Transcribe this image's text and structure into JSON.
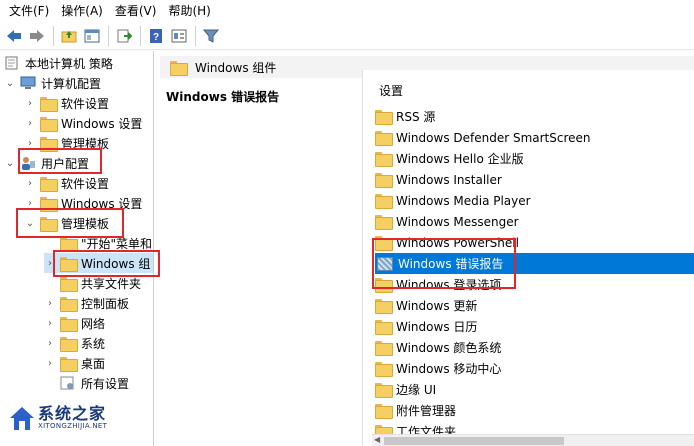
{
  "menu": [
    "文件(F)",
    "操作(A)",
    "查看(V)",
    "帮助(H)"
  ],
  "tree": {
    "root": "本地计算机 策略",
    "computer_config": "计算机配置",
    "cc_software": "软件设置",
    "cc_windows": "Windows 设置",
    "cc_admin": "管理模板",
    "user_config": "用户配置",
    "uc_software": "软件设置",
    "uc_windows": "Windows 设置",
    "uc_admin": "管理模板",
    "start_menu": "\"开始\"菜单和",
    "windows_components": "Windows 组",
    "shared_folders": "共享文件夹",
    "control_panel": "控制面板",
    "network": "网络",
    "system": "系统",
    "desktop": "桌面",
    "all_settings": "所有设置"
  },
  "breadcrumb": "Windows 组件",
  "detail_title": "Windows 错误报告",
  "list": {
    "column": "设置",
    "items": [
      "RSS 源",
      "Windows Defender SmartScreen",
      "Windows Hello 企业版",
      "Windows Installer",
      "Windows Media Player",
      "Windows Messenger",
      "Windows PowerShell",
      "Windows 错误报告",
      "Windows 登录选项",
      "Windows 更新",
      "Windows 日历",
      "Windows 颜色系统",
      "Windows 移动中心",
      "边缘 UI",
      "附件管理器",
      "工作文件夹"
    ],
    "selected_index": 7
  },
  "watermark": {
    "title": "系统之家",
    "sub": "XITONGZHIJIA.NET"
  },
  "colors": {
    "selection": "#0078d7",
    "highlight": "#e0282c",
    "folder": "#f5cf62"
  }
}
